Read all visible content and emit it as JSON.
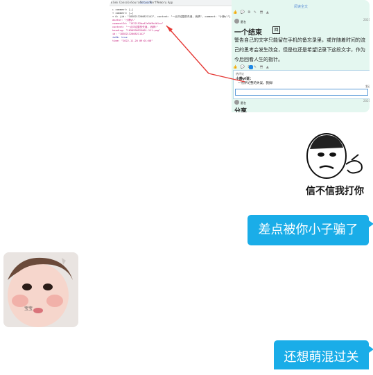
{
  "screenshot": {
    "devtools": {
      "tabs": [
        "Elem",
        "Console",
        "Sources",
        "Network",
        "Perf",
        "Memory",
        "App"
      ],
      "lines": [
        "▸ comment: […]",
        "▾ comment: […]",
        "  ▾ 0: {id: \"1838213200821142\", content: \"一点评论整的失误, 我搞\", comment: \"小静yl\"}",
        "     avatar: \"小静yl\"",
        "     commentId: \"1522192ba42e5d9b4b1ce\"",
        "     content: \"一点评论整的失误, 我搞!\"",
        "     heading: \"1650990925001-111.png\"",
        "     id: \"1838213200821142\"",
        "     isOk: true",
        "     time: \"2022-11-20 09:01:00\""
      ]
    },
    "app": {
      "top_link": "阅读全文",
      "top_date": "2021",
      "author": "匿名",
      "title": "一个结束",
      "title_badge": "回",
      "paragraph": [
        "警告自己的文字只能留在手机的备忘录里，或许随着时间的流",
        "己的思考会发生改变，但是也还是希望记录下这段文字，作为",
        "今后回看人生的指针。"
      ],
      "comment_header": "热评论",
      "comment_user": "小静yl说：",
      "comment_text": "一点评论整的失误，我搞!",
      "send_label": "发送",
      "second_author": "匿名",
      "second_date": "2021",
      "second_title": "分享"
    }
  },
  "messages": {
    "meme_caption": "信不信我打你",
    "msg1": "差点被你小子骗了",
    "baby_label": "宝宝",
    "msg2": "还想萌混过关"
  },
  "colors": {
    "bubble": "#1aade8",
    "bubble_text": "#ffffff",
    "app_bg": "#e4f7f0",
    "arrow": "#e53935"
  }
}
